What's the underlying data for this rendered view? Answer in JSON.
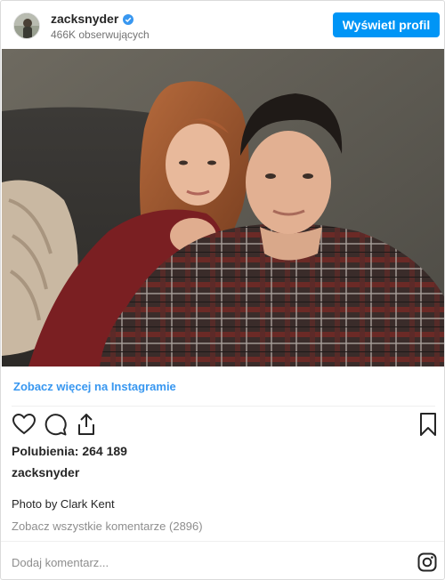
{
  "header": {
    "username": "zacksnyder",
    "verified_icon": "verified-badge-icon",
    "followers": "466K obserwujących",
    "view_profile_label": "Wyświetl profil"
  },
  "post": {
    "see_more_label": "Zobacz więcej na Instagramie",
    "actions": [
      "heart-icon",
      "comment-icon",
      "share-icon",
      "bookmark-icon"
    ],
    "likes": "Polubienia: 264 189",
    "author": "zacksnyder",
    "caption": "Photo by Clark Kent",
    "all_comments": "Zobacz wszystkie komentarze (2896)",
    "add_comment_placeholder": "Dodaj komentarz..."
  },
  "colors": {
    "accent_blue": "#0095f6",
    "link_blue": "#3897f0",
    "muted_text": "#8e8e8e",
    "text": "#262626"
  }
}
